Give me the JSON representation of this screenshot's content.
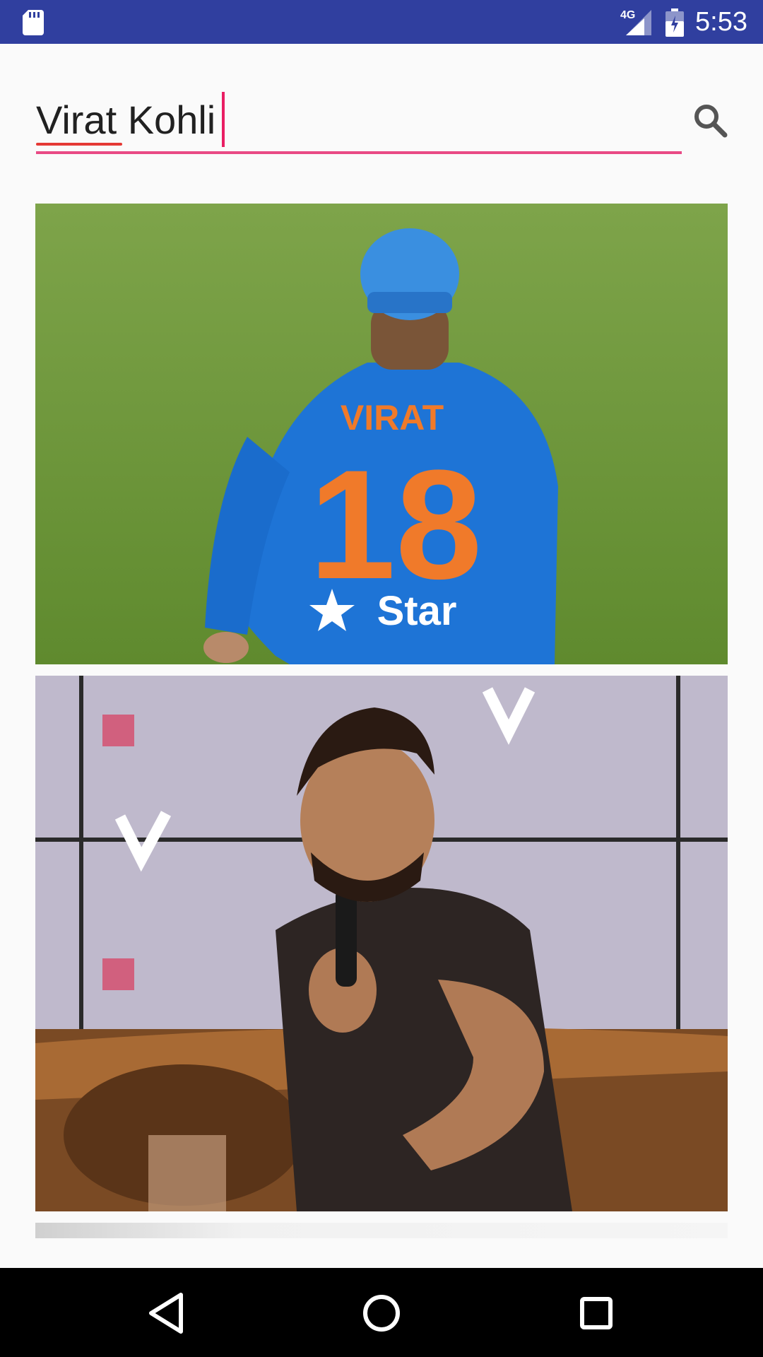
{
  "status_bar": {
    "time": "5:53",
    "network": "4G",
    "background_color": "#303f9f",
    "icons": [
      "sd-card-icon",
      "signal-icon",
      "battery-icon"
    ]
  },
  "search": {
    "value": "Virat Kohli",
    "accent_color": "#e91e63",
    "icon": "search-icon"
  },
  "results": [
    {
      "id": "result-1",
      "jersey_text": "VIRAT",
      "jersey_number": "18",
      "sponsor": "Star"
    },
    {
      "id": "result-2"
    },
    {
      "id": "result-3"
    }
  ],
  "nav_bar": {
    "icons": [
      "back-icon",
      "home-icon",
      "recents-icon"
    ]
  }
}
